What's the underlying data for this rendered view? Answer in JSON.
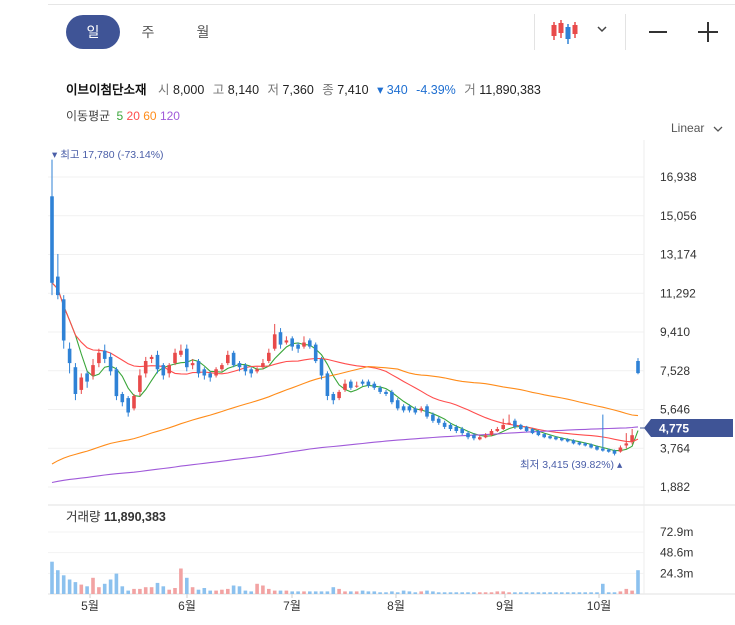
{
  "toolbar": {
    "periods": [
      "일",
      "주",
      "월"
    ],
    "active_period": "일",
    "chart_type_icon": "candlestick-icon",
    "zoom_out_icon": "minus-icon",
    "zoom_in_icon": "plus-icon"
  },
  "quote": {
    "name": "이브이첨단소재",
    "open_label": "시",
    "open": "8,000",
    "high_label": "고",
    "high": "8,140",
    "low_label": "저",
    "low": "7,360",
    "close_label": "종",
    "close": "7,410",
    "change": "▾ 340",
    "change_pct": "-4.39%",
    "volume_label": "거",
    "volume": "11,890,383"
  },
  "moving_average": {
    "label": "이동평균",
    "periods": [
      {
        "value": "5",
        "color": "#3aa63a"
      },
      {
        "value": "20",
        "color": "#ff4d4d"
      },
      {
        "value": "60",
        "color": "#ff8c1a"
      },
      {
        "value": "120",
        "color": "#a05ad9"
      }
    ]
  },
  "scale_mode": "Linear",
  "colors": {
    "up": "#e84a4a",
    "down": "#2f82d6",
    "accent": "#3f5496",
    "last_price_bg": "#3f5496"
  },
  "chart_data": {
    "type": "candlestick",
    "price_axis_ticks": [
      "16,938",
      "15,056",
      "13,174",
      "11,292",
      "9,410",
      "7,528",
      "5,646",
      "3,764",
      "1,882"
    ],
    "price_axis_values": [
      16938,
      15056,
      13174,
      11292,
      9410,
      7528,
      5646,
      3764,
      1882
    ],
    "x_axis_labels": [
      "5월",
      "6월",
      "7월",
      "8월",
      "9월",
      "10월"
    ],
    "last_price": "4,775",
    "high_annotation": "최고 17,780 (-73.14%)",
    "low_annotation": "최저 3,415 (39.82%)",
    "volume_label": "거래량",
    "volume_value": "11,890,383",
    "volume_axis_ticks": [
      "72.9m",
      "48.6m",
      "24.3m"
    ],
    "volume_axis_values": [
      72.9,
      48.6,
      24.3
    ],
    "candles_close": [
      11800,
      11200,
      9000,
      7900,
      6400,
      7200,
      7000,
      7800,
      8400,
      8100,
      7500,
      6300,
      6000,
      5500,
      6300,
      7300,
      8000,
      8200,
      7600,
      7300,
      7800,
      8400,
      8500,
      7700,
      7900,
      7400,
      7300,
      7200,
      7600,
      7800,
      8300,
      7800,
      7700,
      7500,
      7400,
      7600,
      7900,
      8400,
      9300,
      8800,
      9000,
      8700,
      8600,
      8900,
      8700,
      8000,
      7300,
      6300,
      6100,
      6500,
      6900,
      6700,
      6800,
      6900,
      6800,
      6700,
      6500,
      6400,
      6000,
      5700,
      5600,
      5600,
      5500,
      5700,
      5300,
      5100,
      5000,
      4800,
      4700,
      4600,
      4500,
      4300,
      4250,
      4300,
      4400,
      4600,
      4700,
      4900,
      5000,
      4800,
      4700,
      4600,
      4500,
      4400,
      4300,
      4250,
      4200,
      4150,
      4100,
      4000,
      3950,
      3900,
      3800,
      3700,
      3650,
      3600,
      3500,
      3800,
      4000,
      4400,
      7410
    ],
    "candles_open": [
      16000,
      12100,
      11000,
      8600,
      7700,
      6600,
      7400,
      7300,
      7900,
      8500,
      8200,
      7600,
      6400,
      6200,
      5700,
      6500,
      7400,
      8100,
      8300,
      7800,
      7400,
      7900,
      8300,
      8600,
      7800,
      8000,
      7600,
      7400,
      7300,
      7600,
      7900,
      8400,
      7900,
      7800,
      7600,
      7500,
      7700,
      8000,
      8600,
      9400,
      8900,
      9100,
      8800,
      8700,
      9000,
      8800,
      8100,
      7400,
      6400,
      6200,
      6600,
      7000,
      6800,
      7000,
      7000,
      6900,
      6700,
      6500,
      6500,
      6100,
      5800,
      5800,
      5700,
      5600,
      5800,
      5400,
      5200,
      5000,
      4900,
      4800,
      4700,
      4500,
      4400,
      4200,
      4300,
      4400,
      4600,
      4700,
      5000,
      5100,
      4900,
      4800,
      4700,
      4600,
      4450,
      4350,
      4300,
      4250,
      4200,
      4150,
      4050,
      4000,
      3950,
      3850,
      3750,
      3700,
      3650,
      3600,
      3900,
      4100,
      8000
    ],
    "candles_high": [
      17780,
      13200,
      11200,
      8900,
      7900,
      7400,
      7500,
      8100,
      8600,
      8800,
      8400,
      7700,
      6500,
      6300,
      6400,
      7600,
      8200,
      8300,
      8500,
      7900,
      7900,
      8600,
      8800,
      8800,
      8100,
      8100,
      7700,
      7500,
      7700,
      7900,
      8500,
      8500,
      8000,
      7900,
      7700,
      7700,
      8100,
      8600,
      9800,
      9600,
      9200,
      9200,
      8900,
      9200,
      9100,
      8900,
      8200,
      7500,
      6500,
      6600,
      7100,
      7100,
      7000,
      7100,
      7100,
      7000,
      6800,
      6600,
      6600,
      6200,
      5900,
      5900,
      5800,
      5800,
      5900,
      5500,
      5300,
      5100,
      5000,
      4900,
      4800,
      4600,
      4500,
      4400,
      4500,
      4700,
      4800,
      5200,
      5400,
      5200,
      4950,
      4850,
      4750,
      4650,
      4500,
      4400,
      4350,
      4300,
      4250,
      4200,
      4100,
      4050,
      4000,
      3900,
      5400,
      3750,
      3700,
      3900,
      4500,
      4700,
      8140
    ],
    "candles_low": [
      11200,
      11000,
      8600,
      7400,
      6100,
      6400,
      6700,
      7100,
      7700,
      7900,
      7300,
      6100,
      5800,
      5300,
      5600,
      6300,
      7200,
      7900,
      7400,
      7100,
      7200,
      7800,
      8200,
      7500,
      7600,
      7200,
      7100,
      7000,
      7200,
      7500,
      7800,
      7700,
      7500,
      7300,
      7200,
      7400,
      7600,
      7900,
      8500,
      8600,
      8800,
      8500,
      8400,
      8600,
      8600,
      7900,
      7100,
      6100,
      5900,
      6100,
      6500,
      6600,
      6700,
      6800,
      6700,
      6600,
      6400,
      6300,
      5900,
      5600,
      5500,
      5500,
      5400,
      5500,
      5200,
      5000,
      4900,
      4700,
      4600,
      4500,
      4400,
      4200,
      4150,
      4150,
      4250,
      4350,
      4550,
      4650,
      4900,
      4700,
      4650,
      4550,
      4450,
      4350,
      4250,
      4200,
      4150,
      4100,
      4050,
      3950,
      3900,
      3850,
      3750,
      3650,
      3600,
      3550,
      3415,
      3550,
      3750,
      3950,
      7360
    ],
    "volumes": [
      38,
      28,
      22,
      17,
      14,
      11,
      9,
      19,
      8,
      12,
      17,
      24,
      9,
      4,
      6,
      6,
      8,
      8,
      13,
      9,
      5,
      7,
      30,
      19,
      8,
      5,
      7,
      4,
      4,
      5,
      6,
      10,
      9,
      4,
      3,
      12,
      10,
      6,
      4,
      4,
      4,
      3,
      3,
      3,
      3,
      3,
      3,
      3,
      8,
      6,
      3,
      3,
      3,
      4,
      3,
      3,
      2,
      2,
      3,
      2,
      4,
      3,
      2,
      3,
      4,
      3,
      2,
      2,
      2,
      2,
      2,
      2,
      2,
      2,
      2,
      2,
      3,
      3,
      2,
      2,
      2,
      2,
      2,
      2,
      2,
      2,
      2,
      2,
      2,
      2,
      2,
      2,
      2,
      2,
      12,
      2,
      2,
      3,
      6,
      4,
      28
    ]
  }
}
